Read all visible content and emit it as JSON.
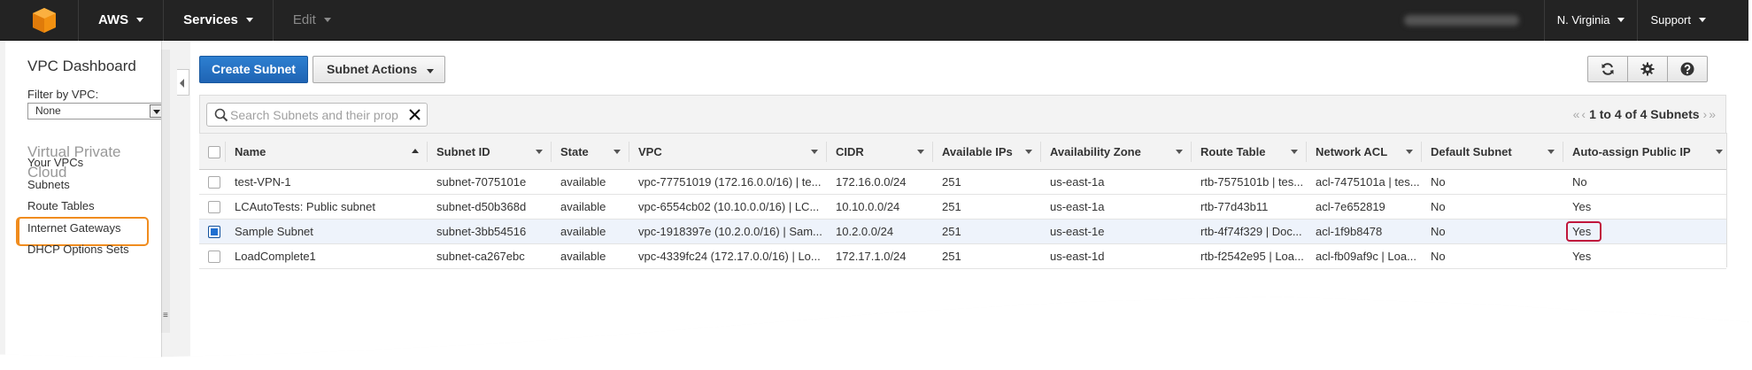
{
  "topbar": {
    "aws_label": "AWS",
    "services_label": "Services",
    "edit_label": "Edit",
    "region_label": "N. Virginia",
    "support_label": "Support"
  },
  "sidebar": {
    "title": "VPC Dashboard",
    "filter_label": "Filter by VPC:",
    "filter_value": "None",
    "section_title": "Virtual Private Cloud",
    "links": [
      "Your VPCs",
      "Subnets",
      "Route Tables",
      "Internet Gateways",
      "DHCP Options Sets"
    ],
    "active_link": "Subnets"
  },
  "toolbar": {
    "create_label": "Create Subnet",
    "actions_label": "Subnet Actions",
    "icons": [
      "refresh-icon",
      "gear-icon",
      "help-icon"
    ]
  },
  "search": {
    "placeholder": "Search Subnets and their prop"
  },
  "pagination": {
    "text": "1 to 4 of 4 Subnets"
  },
  "table": {
    "columns": [
      "Name",
      "Subnet ID",
      "State",
      "VPC",
      "CIDR",
      "Available IPs",
      "Availability Zone",
      "Route Table",
      "Network ACL",
      "Default Subnet",
      "Auto-assign Public IP"
    ],
    "rows": [
      {
        "name": "test-VPN-1",
        "subnet_id": "subnet-7075101e",
        "state": "available",
        "vpc": "vpc-77751019 (172.16.0.0/16) | te...",
        "cidr": "172.16.0.0/24",
        "ips": "251",
        "az": "us-east-1a",
        "route": "rtb-7575101b | tes...",
        "acl": "acl-7475101a | tes...",
        "default": "No",
        "auto": "No",
        "selected": false
      },
      {
        "name": "LCAutoTests: Public subnet",
        "subnet_id": "subnet-d50b368d",
        "state": "available",
        "vpc": "vpc-6554cb02 (10.10.0.0/16) | LC...",
        "cidr": "10.10.0.0/24",
        "ips": "251",
        "az": "us-east-1a",
        "route": "rtb-77d43b11",
        "acl": "acl-7e652819",
        "default": "No",
        "auto": "Yes",
        "selected": false
      },
      {
        "name": "Sample Subnet",
        "subnet_id": "subnet-3bb54516",
        "state": "available",
        "vpc": "vpc-1918397e (10.2.0.0/16) | Sam...",
        "cidr": "10.2.0.0/24",
        "ips": "251",
        "az": "us-east-1e",
        "route": "rtb-4f74f329 | Doc...",
        "acl": "acl-1f9b8478",
        "default": "No",
        "auto": "Yes",
        "selected": true
      },
      {
        "name": "LoadComplete1",
        "subnet_id": "subnet-ca267ebc",
        "state": "available",
        "vpc": "vpc-4339fc24 (172.17.0.0/16) | Lo...",
        "cidr": "172.17.1.0/24",
        "ips": "251",
        "az": "us-east-1d",
        "route": "rtb-f2542e95 | Loa...",
        "acl": "acl-fb09af9c | Loa...",
        "default": "No",
        "auto": "Yes",
        "selected": false
      }
    ]
  },
  "colors": {
    "topbar_bg": "#232323",
    "primary_button": "#1f64b4",
    "state_available": "#1a9c1a",
    "active_nav_highlight": "#f08c1e",
    "annotation_highlight": "#c0163c"
  }
}
